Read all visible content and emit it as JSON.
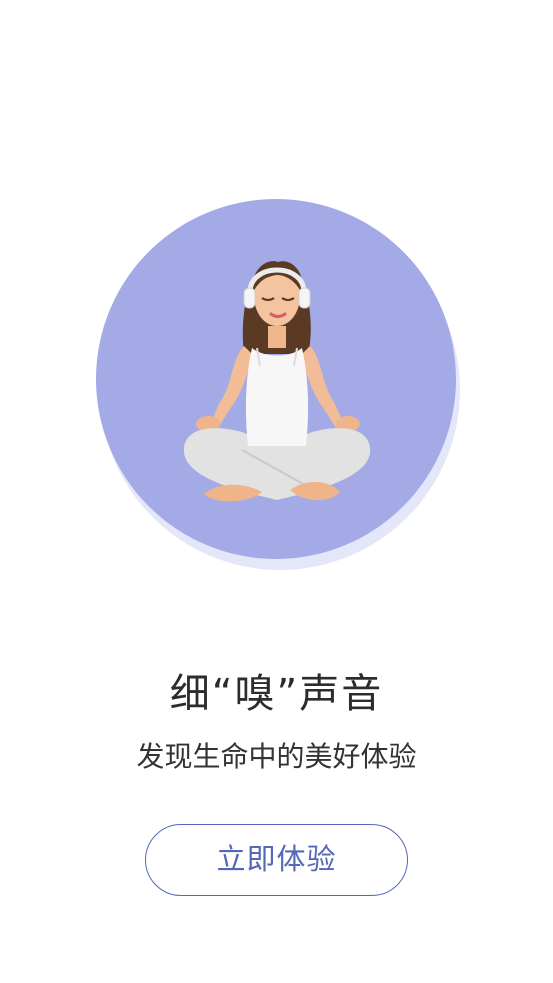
{
  "intro": {
    "title": "细“嗅”声音",
    "subtitle": "发现生命中的美好体验",
    "button_label": "立即体验"
  },
  "colors": {
    "circle": "#a3aae6",
    "circle_shadow": "#e4e6fa",
    "accent": "#5568b8"
  }
}
